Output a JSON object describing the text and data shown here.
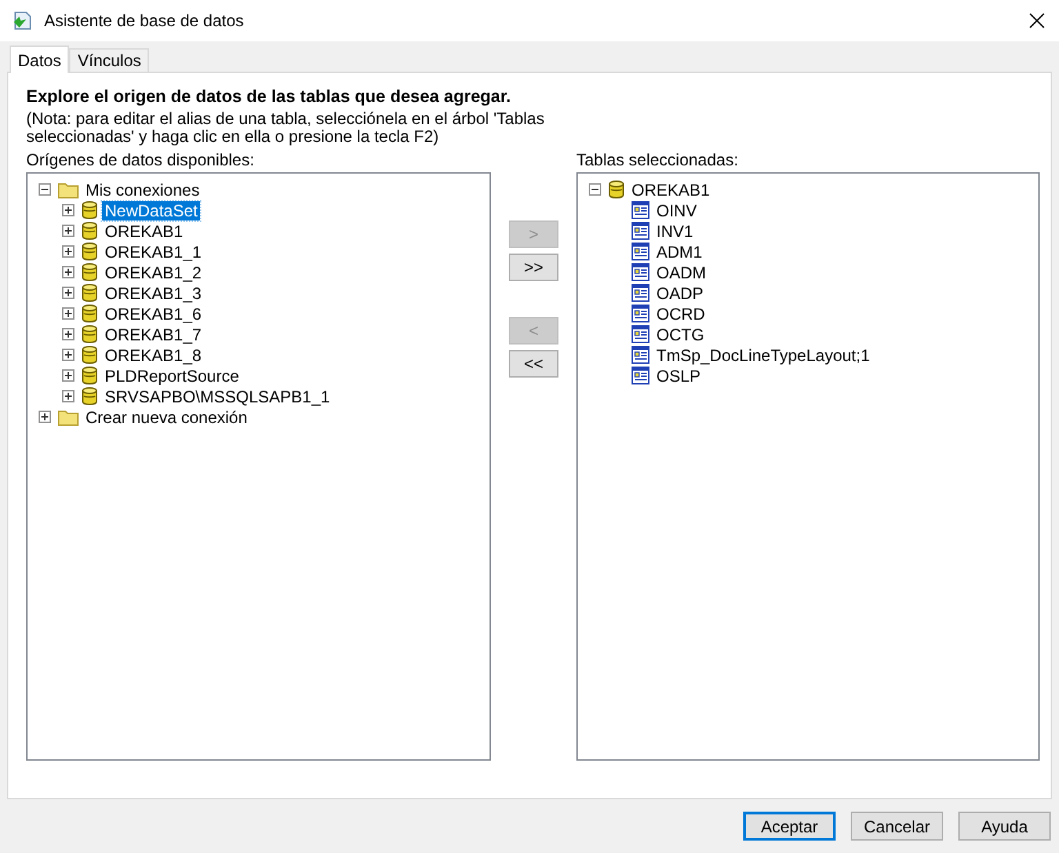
{
  "window": {
    "title": "Asistente de base de datos"
  },
  "tabs": [
    {
      "label": "Datos",
      "selected": true
    },
    {
      "label": "Vínculos",
      "selected": false
    }
  ],
  "heading": "Explore el origen de datos de las tablas que desea agregar.",
  "note": "(Nota: para editar el alias de una tabla, selecciónela en el árbol 'Tablas seleccionadas' y haga clic en ella o presione la tecla F2)",
  "sources": {
    "label": "Orígenes de datos disponibles:",
    "tree": [
      {
        "label": "Mis conexiones",
        "kind": "folder",
        "expanded": true,
        "selected": false,
        "children": [
          {
            "label": "NewDataSet",
            "kind": "database",
            "expanded": false,
            "selected": true
          },
          {
            "label": "OREKAB1",
            "kind": "database",
            "expanded": false,
            "selected": false
          },
          {
            "label": "OREKAB1_1",
            "kind": "database",
            "expanded": false,
            "selected": false
          },
          {
            "label": "OREKAB1_2",
            "kind": "database",
            "expanded": false,
            "selected": false
          },
          {
            "label": "OREKAB1_3",
            "kind": "database",
            "expanded": false,
            "selected": false
          },
          {
            "label": "OREKAB1_6",
            "kind": "database",
            "expanded": false,
            "selected": false
          },
          {
            "label": "OREKAB1_7",
            "kind": "database",
            "expanded": false,
            "selected": false
          },
          {
            "label": "OREKAB1_8",
            "kind": "database",
            "expanded": false,
            "selected": false
          },
          {
            "label": "PLDReportSource",
            "kind": "database",
            "expanded": false,
            "selected": false
          },
          {
            "label": "SRVSAPBO\\MSSQLSAPB1_1",
            "kind": "database",
            "expanded": false,
            "selected": false
          }
        ]
      },
      {
        "label": "Crear nueva conexión",
        "kind": "folder",
        "expanded": false,
        "selected": false
      }
    ]
  },
  "transfer_buttons": [
    {
      "label": ">",
      "disabled": true
    },
    {
      "label": ">>",
      "disabled": false
    },
    {
      "label": "<",
      "disabled": true
    },
    {
      "label": "<<",
      "disabled": false
    }
  ],
  "selected_tables": {
    "label": "Tablas seleccionadas:",
    "tree": [
      {
        "label": "OREKAB1",
        "kind": "database",
        "expanded": true,
        "selected": false,
        "children": [
          {
            "label": "OINV",
            "kind": "table",
            "selected": false
          },
          {
            "label": "INV1",
            "kind": "table",
            "selected": false
          },
          {
            "label": "ADM1",
            "kind": "table",
            "selected": false
          },
          {
            "label": "OADM",
            "kind": "table",
            "selected": false
          },
          {
            "label": "OADP",
            "kind": "table",
            "selected": false
          },
          {
            "label": "OCRD",
            "kind": "table",
            "selected": false
          },
          {
            "label": "OCTG",
            "kind": "table",
            "selected": false
          },
          {
            "label": "TmSp_DocLineTypeLayout;1",
            "kind": "table",
            "selected": false
          },
          {
            "label": "OSLP",
            "kind": "table",
            "selected": false
          }
        ]
      }
    ]
  },
  "buttons": [
    {
      "label": "Aceptar",
      "default": true
    },
    {
      "label": "Cancelar",
      "default": false
    },
    {
      "label": "Ayuda",
      "default": false
    }
  ]
}
